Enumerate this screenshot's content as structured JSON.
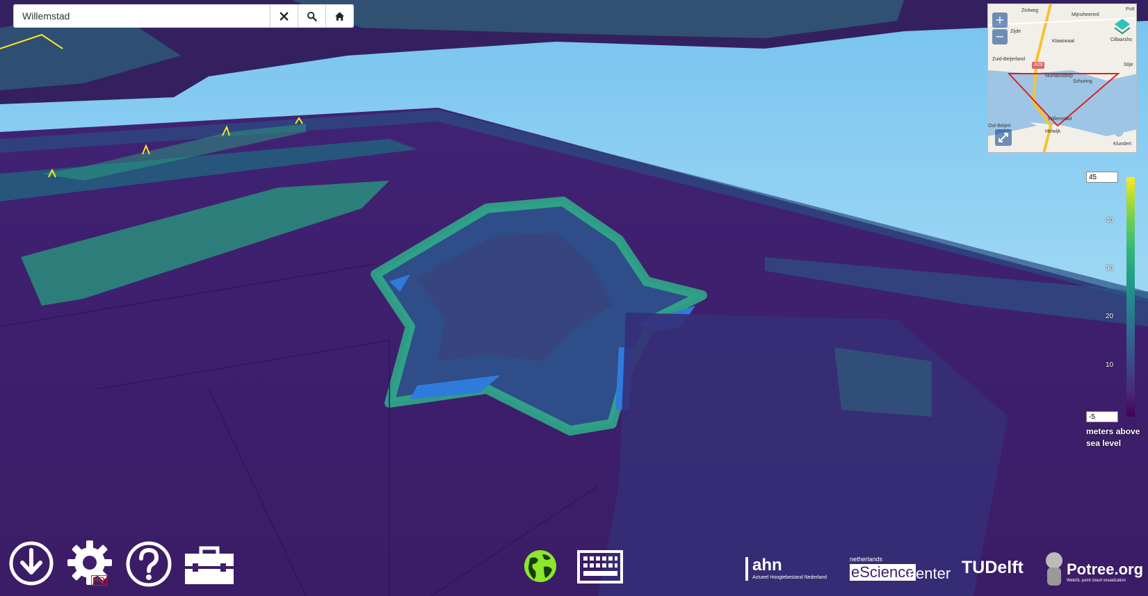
{
  "search": {
    "value": "Willemstad",
    "placeholder": "",
    "clear_icon": "close-icon",
    "search_icon": "search-icon",
    "home_icon": "home-icon"
  },
  "minimap": {
    "zoom_in": "+",
    "zoom_out": "−",
    "labels": [
      "Zinlweg",
      "Mijnsheerenl",
      "Putt",
      "Zijde",
      "Klaaswaal",
      "Cillaarsho",
      "Zuid-Beijerland",
      "A29",
      "Numansdorp",
      "Schuring",
      "Stije",
      "Willemstad",
      "Helwijk",
      "Klundert",
      "Ool-Beijerl"
    ],
    "expand_icon": "expand-icon",
    "layers_icon": "layers-icon"
  },
  "legend": {
    "max_value": "45",
    "min_value": "-5",
    "ticks": [
      "40",
      "30",
      "20",
      "10"
    ],
    "unit": "meters above sea level"
  },
  "toolbar": {
    "download_icon": "download-icon",
    "settings_icon": "gear-icon",
    "settings_badge": "HQ",
    "help_icon": "help-icon",
    "toolbox_icon": "toolbox-icon",
    "globe_icon": "globe-icon",
    "keyboard_icon": "keyboard-icon"
  },
  "logos": {
    "ahn": "ahn",
    "ahn_sub": "Actueel Hoogtebestand Nederland",
    "esc_top": "netherlands",
    "esc_main": "eScience",
    "esc_center": "center",
    "tudelft": "TUDelft",
    "potree": "Potree.org",
    "potree_sub": "WebGL point cloud visualization"
  },
  "colors": {
    "ground": "#3f1f6b",
    "sky": "#9fd8f7",
    "teal": "#26828e",
    "green": "#35b779",
    "yellow": "#fde725",
    "water": "#2f7bdc"
  }
}
